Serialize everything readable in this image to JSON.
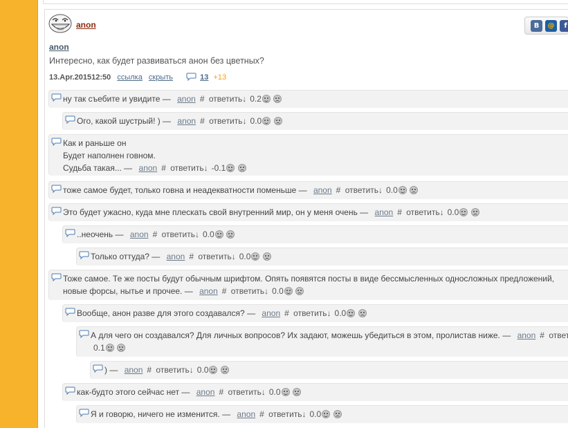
{
  "post": {
    "author_top": "anon",
    "op_name": "anon",
    "op_text": "Интересно, как будет развиваться анон без цветных?",
    "date": "13.Apr.201512:50",
    "link_label": "ссылка",
    "hide_label": "скрыть",
    "comment_count": "13",
    "new_count": "+13",
    "share": {
      "vk": "В",
      "mail": "@",
      "fb": "f"
    }
  },
  "comments": [
    {
      "lines": [
        "ну так съебите и увидите —"
      ],
      "author": "anon",
      "hash": "#",
      "reply": "ответить↓",
      "score": "0.2"
    },
    {
      "lines": [
        "Ого, какой шустрый! ) —"
      ],
      "author": "anon",
      "hash": "#",
      "reply": "ответить↓",
      "score": "0.0"
    },
    {
      "lines": [
        "Как и раньше он",
        "Будет наполнен говном.",
        "Судьба такая... —"
      ],
      "author": "anon",
      "hash": "#",
      "reply": "ответить↓",
      "score": "-0.1"
    },
    {
      "lines": [
        "тоже самое будет, только говна и неадекватности поменьше —"
      ],
      "author": "anon",
      "hash": "#",
      "reply": "ответить↓",
      "score": "0.0"
    },
    {
      "lines": [
        "Это будет ужасно, куда мне плескать свой внутренний мир, он у меня очень —"
      ],
      "author": "anon",
      "hash": "#",
      "reply": "ответить↓",
      "score": "0.0"
    },
    {
      "lines": [
        "..неочень —"
      ],
      "author": "anon",
      "hash": "#",
      "reply": "ответить↓",
      "score": "0.0"
    },
    {
      "lines": [
        "Только оттуда? —"
      ],
      "author": "anon",
      "hash": "#",
      "reply": "ответить↓",
      "score": "0.0"
    },
    {
      "lines": [
        "Тоже самое. Те же посты будут обычным шрифтом. Опять появятся посты в виде бессмысленных односложных предложений, ",
        "новые форсы, нытье и прочее. —"
      ],
      "author": "anon",
      "hash": "#",
      "reply": "ответить↓",
      "score": "0.0"
    },
    {
      "lines": [
        "Вообще, анон разве для этого создавался? —"
      ],
      "author": "anon",
      "hash": "#",
      "reply": "ответить↓",
      "score": "0.0"
    },
    {
      "lines": [
        "А для чего он создавался? Для личных вопросов? Их задают, можешь убедиться в этом, пролистав ниже. —"
      ],
      "author": "anon",
      "hash": "#",
      "reply": "ответить↓",
      "score": "0.1"
    },
    {
      "lines": [
        ") —"
      ],
      "author": "anon",
      "hash": "#",
      "reply": "ответить↓",
      "score": "0.0"
    },
    {
      "lines": [
        "как-будто этого сейчас нет —"
      ],
      "author": "anon",
      "hash": "#",
      "reply": "ответить↓",
      "score": "0.0"
    },
    {
      "lines": [
        "Я и говорю, ничего не изменится. —"
      ],
      "author": "anon",
      "hash": "#",
      "reply": "ответить↓",
      "score": "0.0"
    }
  ]
}
